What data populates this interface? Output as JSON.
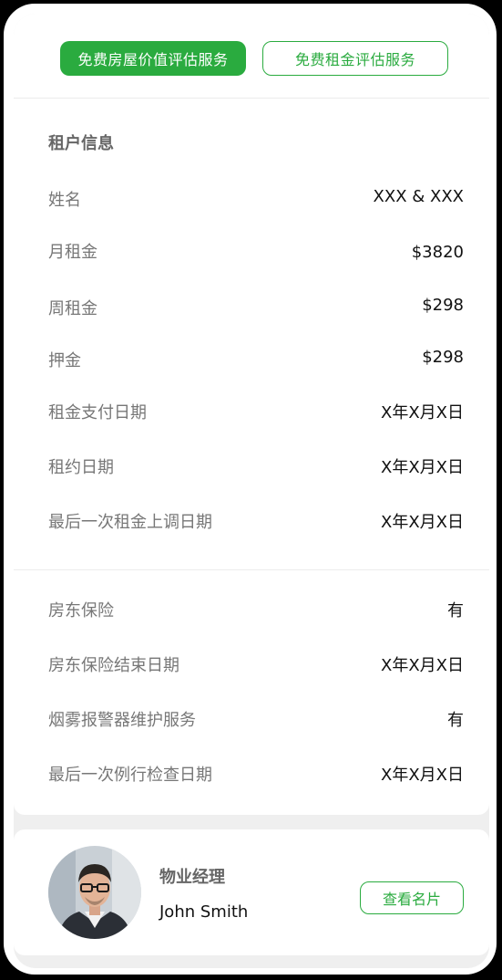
{
  "top_buttons": {
    "primary_label": "免费房屋价值评估服务",
    "secondary_label": "免费租金评估服务"
  },
  "tenant_info": {
    "title": "租户信息",
    "rows": [
      {
        "label": "姓名",
        "value": "XXX & XXX"
      },
      {
        "label": "月租金",
        "value": "$3820"
      },
      {
        "label": "周租金",
        "value": "$298"
      },
      {
        "label": "押金",
        "value": "$298"
      },
      {
        "label": "租金支付日期",
        "value": "X年X月X日"
      },
      {
        "label": "租约日期",
        "value": "X年X月X日"
      },
      {
        "label": "最后一次租金上调日期",
        "value": "X年X月X日"
      }
    ]
  },
  "property_info": {
    "rows": [
      {
        "label": "房东保险",
        "value": "有"
      },
      {
        "label": "房东保险结束日期",
        "value": "X年X月X日"
      },
      {
        "label": "烟雾报警器维护服务",
        "value": "有"
      },
      {
        "label": "最后一次例行检查日期",
        "value": "X年X月X日"
      }
    ]
  },
  "manager": {
    "title": "物业经理",
    "name": "John Smith",
    "button_label": "查看名片"
  },
  "colors": {
    "accent": "#2aab3f"
  }
}
